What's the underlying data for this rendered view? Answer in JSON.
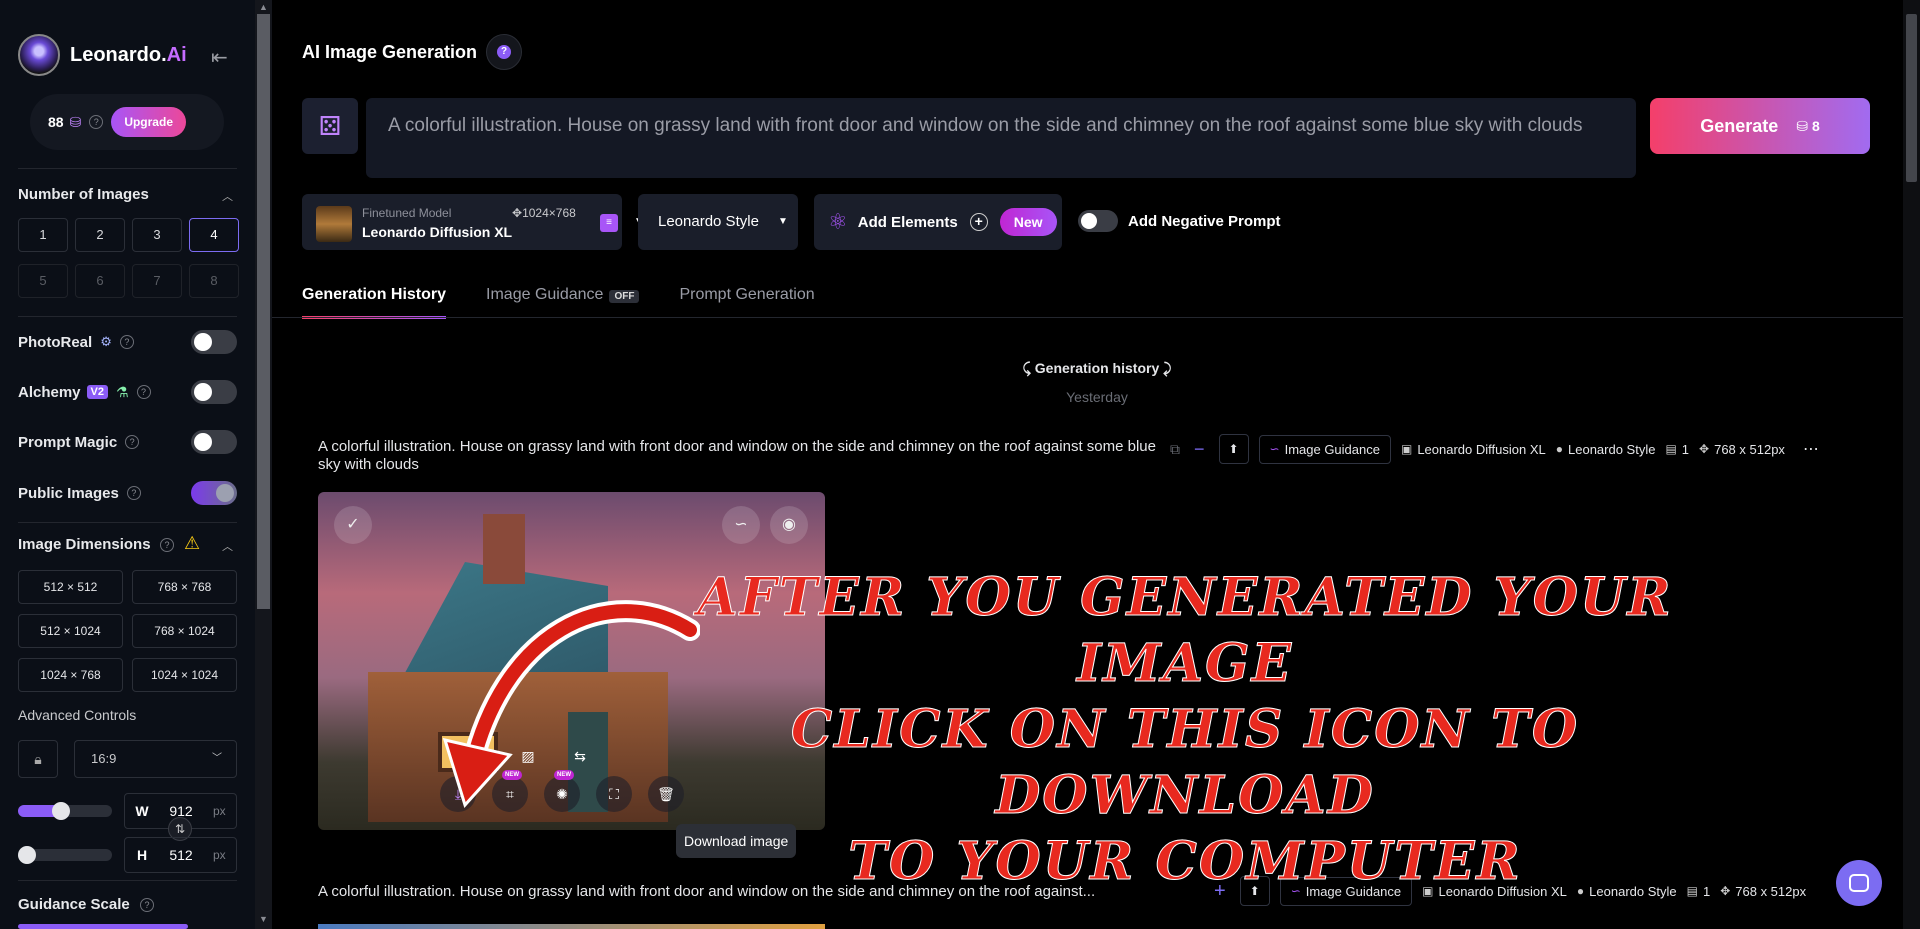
{
  "sidebar": {
    "brand": "Leonardo.",
    "brand_ai": "Ai",
    "credits": "88",
    "upgrade": "Upgrade",
    "num_images": {
      "title": "Number of Images",
      "options": [
        "1",
        "2",
        "3",
        "4",
        "5",
        "6",
        "7",
        "8"
      ],
      "selected": "4"
    },
    "photoreal": "PhotoReal",
    "alchemy": "Alchemy",
    "alchemy_badge": "V2",
    "prompt_magic": "Prompt Magic",
    "public_images": "Public Images",
    "image_dimensions": {
      "title": "Image Dimensions",
      "options": [
        "512 × 512",
        "768 × 768",
        "512 × 1024",
        "768 × 1024",
        "1024 × 768",
        "1024 × 1024"
      ]
    },
    "advanced_controls": "Advanced Controls",
    "ratio": "16:9",
    "width_label": "W",
    "width": "912",
    "height_label": "H",
    "height": "512",
    "unit": "px",
    "guidance_scale": "Guidance Scale",
    "width_slider_level": 0.45,
    "height_slider_level": 0.0
  },
  "header": {
    "title": "AI Image Generation",
    "prompt": "A colorful illustration. House on grassy land with front door and window on the side and chimney on the roof against some blue sky with clouds",
    "generate": "Generate",
    "generate_cost": "8"
  },
  "controls": {
    "model_sub": "Finetuned Model",
    "model_res": "1024×768",
    "model_name": "Leonardo Diffusion XL",
    "style": "Leonardo Style",
    "add_elements": "Add Elements",
    "new_badge": "New",
    "negative_prompt": "Add Negative Prompt"
  },
  "tabs": [
    {
      "label": "Generation History"
    },
    {
      "label": "Image Guidance",
      "badge": "OFF"
    },
    {
      "label": "Prompt Generation"
    }
  ],
  "history": {
    "title": "Generation history",
    "subtitle": "Yesterday",
    "rows": [
      {
        "prompt": "A colorful illustration. House on grassy land with front door and window on the side and chimney on the roof against some blue sky with clouds",
        "guidance": "Image Guidance",
        "model": "Leonardo Diffusion XL",
        "style": "Leonardo Style",
        "count": "1",
        "size": "768 x 512px"
      },
      {
        "prompt": "A colorful illustration. House on grassy land with front door and window on the side and chimney on the roof against...",
        "guidance": "Image Guidance",
        "model": "Leonardo Diffusion XL",
        "style": "Leonardo Style",
        "count": "1",
        "size": "768 x 512px"
      }
    ],
    "new_tag": "NEW",
    "tooltip": "Download image"
  },
  "annotation": {
    "line1": "After you generated your image",
    "line2": "click on this icon to download",
    "line3": "to your computer"
  },
  "colors": {
    "accent": "#8b5cf6",
    "generate_start": "#f43f6a",
    "generate_end": "#a16bf0",
    "annotation": "#e8291f"
  }
}
